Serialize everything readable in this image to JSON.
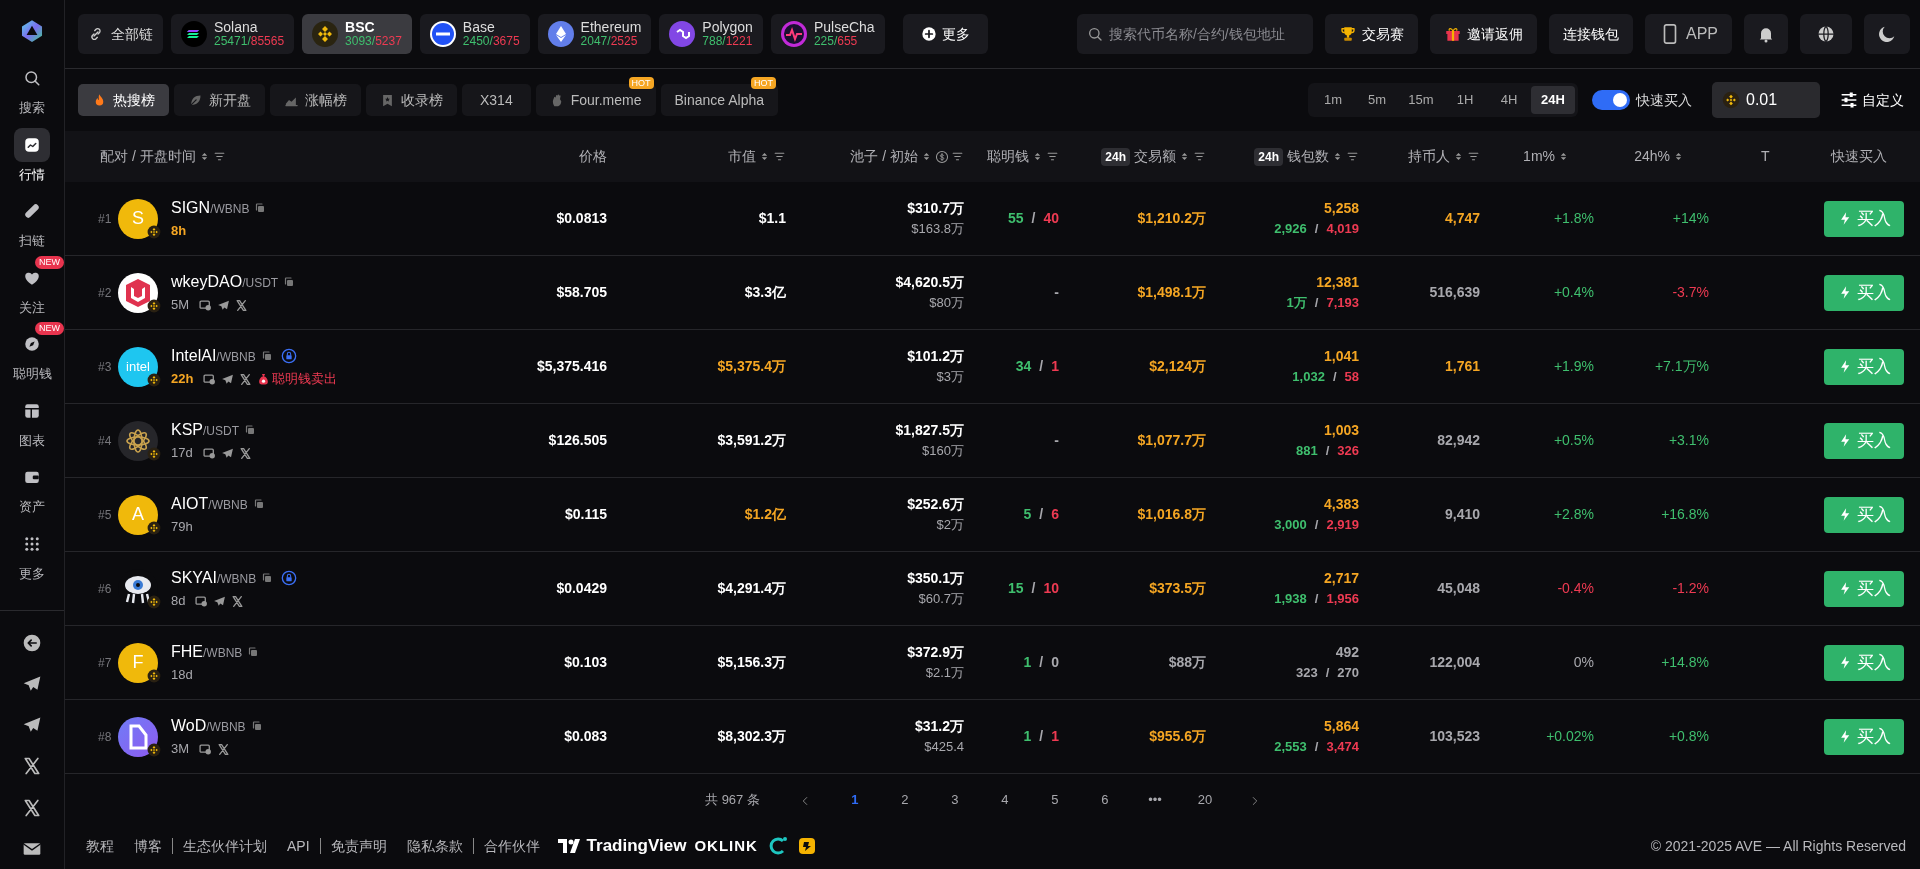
{
  "sidebar": {
    "items": [
      {
        "label": "搜索",
        "selected": false
      },
      {
        "label": "行情",
        "selected": true
      },
      {
        "label": "扫链",
        "selected": false
      },
      {
        "label": "关注",
        "selected": false,
        "badge": "NEW"
      },
      {
        "label": "聪明钱",
        "selected": false,
        "badge": "NEW"
      },
      {
        "label": "图表",
        "selected": false
      },
      {
        "label": "资产",
        "selected": false
      },
      {
        "label": "更多",
        "selected": false
      }
    ]
  },
  "chains": [
    {
      "label": "全部链",
      "selected": false
    },
    {
      "label": "Solana",
      "counts": [
        "25471",
        "/",
        "85565"
      ],
      "selected": false
    },
    {
      "label": "BSC",
      "counts": [
        "3093",
        "/",
        "5237"
      ],
      "selected": true
    },
    {
      "label": "Base",
      "counts": [
        "2450",
        "/",
        "3675"
      ],
      "selected": false
    },
    {
      "label": "Ethereum",
      "counts": [
        "2047",
        "/",
        "2525"
      ],
      "selected": false
    },
    {
      "label": "Polygon",
      "counts": [
        "788",
        "/",
        "1221"
      ],
      "selected": false
    },
    {
      "label": "PulseCha",
      "counts": [
        "225",
        "/",
        "655"
      ],
      "selected": false
    }
  ],
  "more_button": "更多",
  "search": {
    "placeholder": "搜索代币名称/合约/钱包地址"
  },
  "top_buttons": [
    "交易赛",
    "邀请返佣",
    "连接钱包",
    "APP"
  ],
  "filters": [
    {
      "label": "热搜榜",
      "selected": true
    },
    {
      "label": "新开盘",
      "selected": false
    },
    {
      "label": "涨幅榜",
      "selected": false
    },
    {
      "label": "收录榜",
      "selected": false
    },
    {
      "label": "X314",
      "selected": false
    },
    {
      "label": "Four.meme",
      "selected": false,
      "badge": "HOT"
    },
    {
      "label": "Binance Alpha",
      "selected": false,
      "badge": "HOT"
    }
  ],
  "intervals": [
    {
      "label": "1m",
      "selected": false
    },
    {
      "label": "5m",
      "selected": false
    },
    {
      "label": "15m",
      "selected": false
    },
    {
      "label": "1H",
      "selected": false
    },
    {
      "label": "4H",
      "selected": false
    },
    {
      "label": "24H",
      "selected": true
    }
  ],
  "quick_buy": {
    "label": "快速买入",
    "on": true,
    "amount": "0.01"
  },
  "customize": "自定义",
  "columns": [
    {
      "label": "配对 / 开盘时间",
      "sort": true,
      "filter": true
    },
    {
      "label": "价格"
    },
    {
      "label": "市值",
      "sort": true,
      "filter": true
    },
    {
      "label": "池子 / 初始",
      "sort": true,
      "currency": true,
      "filter": true
    },
    {
      "label": "聪明钱",
      "sort": true,
      "filter": true
    },
    {
      "badge": "24h",
      "label": "交易额",
      "sort": true,
      "filter": true
    },
    {
      "badge": "24h",
      "label": "钱包数",
      "sort": true,
      "filter": true
    },
    {
      "label": "持币人",
      "sort": true,
      "filter": true
    },
    {
      "label": "1m%",
      "sort": true
    },
    {
      "label": "24h%",
      "sort": true
    },
    {
      "label": "T"
    },
    {
      "label": "快速买入"
    }
  ],
  "rows": [
    {
      "rank": "#1",
      "avatar": {
        "kind": "letter",
        "text": "S"
      },
      "symbol": "SIGN",
      "quote": "/WBNB",
      "age": "8h",
      "age_hot": true,
      "links": [],
      "lock": false,
      "price": "$0.0813",
      "mcap": {
        "text": "$1.1",
        "color": "#ffffff"
      },
      "pool": "$310.7万",
      "initial": "$163.8万",
      "smart": [
        {
          "text": "55",
          "color": "#3fbf6e"
        },
        {
          "text": "/",
          "color": "#a8a8ad"
        },
        {
          "text": "40",
          "color": "#ee3a52"
        }
      ],
      "volume": {
        "text": "$1,210.2万",
        "color": "#f5a623"
      },
      "wallets": {
        "text": "5,258",
        "color": "#f5a623"
      },
      "traders": [
        {
          "text": "2,926",
          "color": "#3fbf6e"
        },
        {
          "text": "/",
          "color": "#a8a8ad"
        },
        {
          "text": "4,019",
          "color": "#ee3a52"
        }
      ],
      "holders": {
        "text": "4,747",
        "color": "#f5a623"
      },
      "change_1m": {
        "text": "+1.8%",
        "color": "#3fbf6e"
      },
      "change_24h": {
        "text": "+14%",
        "color": "#3fbf6e"
      },
      "buy": "买入"
    },
    {
      "rank": "#2",
      "avatar": {
        "kind": "shield"
      },
      "symbol": "wkeyDAO",
      "quote": "/USDT",
      "age": "5M",
      "age_hot": false,
      "links": [
        {
          "kind": "web"
        },
        {
          "kind": "telegram"
        },
        {
          "kind": "x"
        }
      ],
      "lock": false,
      "price": "$58.705",
      "mcap": {
        "text": "$3.3亿",
        "color": "#ffffff"
      },
      "pool": "$4,620.5万",
      "initial": "$80万",
      "smart": [
        {
          "text": "-",
          "color": "#a8a8ad"
        }
      ],
      "volume": {
        "text": "$1,498.1万",
        "color": "#f5a623"
      },
      "wallets": {
        "text": "12,381",
        "color": "#f5a623"
      },
      "traders": [
        {
          "text": "1万",
          "color": "#3fbf6e"
        },
        {
          "text": "/",
          "color": "#a8a8ad"
        },
        {
          "text": "7,193",
          "color": "#ee3a52"
        }
      ],
      "holders": {
        "text": "516,639",
        "color": "#a8a8ad"
      },
      "change_1m": {
        "text": "+0.4%",
        "color": "#3fbf6e"
      },
      "change_24h": {
        "text": "-3.7%",
        "color": "#ee3a52"
      },
      "buy": "买入"
    },
    {
      "rank": "#3",
      "avatar": {
        "kind": "text",
        "text": "intel"
      },
      "symbol": "IntelAI",
      "quote": "/WBNB",
      "age": "22h",
      "age_hot": true,
      "links": [
        {
          "kind": "web"
        },
        {
          "kind": "telegram"
        },
        {
          "kind": "x"
        }
      ],
      "lock": true,
      "alert": "聪明钱卖出",
      "price": "$5,375.416",
      "mcap": {
        "text": "$5,375.4万",
        "color": "#f5a623"
      },
      "pool": "$101.2万",
      "initial": "$3万",
      "smart": [
        {
          "text": "34",
          "color": "#3fbf6e"
        },
        {
          "text": "/",
          "color": "#a8a8ad"
        },
        {
          "text": "1",
          "color": "#ee3a52"
        }
      ],
      "volume": {
        "text": "$2,124万",
        "color": "#f5a623"
      },
      "wallets": {
        "text": "1,041",
        "color": "#f5a623"
      },
      "traders": [
        {
          "text": "1,032",
          "color": "#3fbf6e"
        },
        {
          "text": "/",
          "color": "#a8a8ad"
        },
        {
          "text": "58",
          "color": "#ee3a52"
        }
      ],
      "holders": {
        "text": "1,761",
        "color": "#f5a623"
      },
      "change_1m": {
        "text": "+1.9%",
        "color": "#3fbf6e"
      },
      "change_24h": {
        "text": "+7.1万%",
        "color": "#3fbf6e"
      },
      "buy": "买入"
    },
    {
      "rank": "#4",
      "avatar": {
        "kind": "flower"
      },
      "symbol": "KSP",
      "quote": "/USDT",
      "age": "17d",
      "age_hot": false,
      "links": [
        {
          "kind": "web"
        },
        {
          "kind": "telegram"
        },
        {
          "kind": "x"
        }
      ],
      "lock": false,
      "price": "$126.505",
      "mcap": {
        "text": "$3,591.2万",
        "color": "#ffffff"
      },
      "pool": "$1,827.5万",
      "initial": "$160万",
      "smart": [
        {
          "text": "-",
          "color": "#a8a8ad"
        }
      ],
      "volume": {
        "text": "$1,077.7万",
        "color": "#f5a623"
      },
      "wallets": {
        "text": "1,003",
        "color": "#f5a623"
      },
      "traders": [
        {
          "text": "881",
          "color": "#3fbf6e"
        },
        {
          "text": "/",
          "color": "#a8a8ad"
        },
        {
          "text": "326",
          "color": "#ee3a52"
        }
      ],
      "holders": {
        "text": "82,942",
        "color": "#a8a8ad"
      },
      "change_1m": {
        "text": "+0.5%",
        "color": "#3fbf6e"
      },
      "change_24h": {
        "text": "+3.1%",
        "color": "#3fbf6e"
      },
      "buy": "买入"
    },
    {
      "rank": "#5",
      "avatar": {
        "kind": "letter",
        "text": "A"
      },
      "symbol": "AIOT",
      "quote": "/WBNB",
      "age": "79h",
      "age_hot": false,
      "links": [],
      "lock": false,
      "price": "$0.115",
      "mcap": {
        "text": "$1.2亿",
        "color": "#f5a623"
      },
      "pool": "$252.6万",
      "initial": "$2万",
      "smart": [
        {
          "text": "5",
          "color": "#3fbf6e"
        },
        {
          "text": "/",
          "color": "#a8a8ad"
        },
        {
          "text": "6",
          "color": "#ee3a52"
        }
      ],
      "volume": {
        "text": "$1,016.8万",
        "color": "#f5a623"
      },
      "wallets": {
        "text": "4,383",
        "color": "#f5a623"
      },
      "traders": [
        {
          "text": "3,000",
          "color": "#3fbf6e"
        },
        {
          "text": "/",
          "color": "#a8a8ad"
        },
        {
          "text": "2,919",
          "color": "#ee3a52"
        }
      ],
      "holders": {
        "text": "9,410",
        "color": "#a8a8ad"
      },
      "change_1m": {
        "text": "+2.8%",
        "color": "#3fbf6e"
      },
      "change_24h": {
        "text": "+16.8%",
        "color": "#3fbf6e"
      },
      "buy": "买入"
    },
    {
      "rank": "#6",
      "avatar": {
        "kind": "robot"
      },
      "symbol": "SKYAI",
      "quote": "/WBNB",
      "age": "8d",
      "age_hot": false,
      "links": [
        {
          "kind": "web"
        },
        {
          "kind": "telegram"
        },
        {
          "kind": "x"
        }
      ],
      "lock": true,
      "price": "$0.0429",
      "mcap": {
        "text": "$4,291.4万",
        "color": "#ffffff"
      },
      "pool": "$350.1万",
      "initial": "$60.7万",
      "smart": [
        {
          "text": "15",
          "color": "#3fbf6e"
        },
        {
          "text": "/",
          "color": "#a8a8ad"
        },
        {
          "text": "10",
          "color": "#ee3a52"
        }
      ],
      "volume": {
        "text": "$373.5万",
        "color": "#f5a623"
      },
      "wallets": {
        "text": "2,717",
        "color": "#f5a623"
      },
      "traders": [
        {
          "text": "1,938",
          "color": "#3fbf6e"
        },
        {
          "text": "/",
          "color": "#a8a8ad"
        },
        {
          "text": "1,956",
          "color": "#ee3a52"
        }
      ],
      "holders": {
        "text": "45,048",
        "color": "#a8a8ad"
      },
      "change_1m": {
        "text": "-0.4%",
        "color": "#ee3a52"
      },
      "change_24h": {
        "text": "-1.2%",
        "color": "#ee3a52"
      },
      "buy": "买入"
    },
    {
      "rank": "#7",
      "avatar": {
        "kind": "letter",
        "text": "F"
      },
      "symbol": "FHE",
      "quote": "/WBNB",
      "age": "18d",
      "age_hot": false,
      "links": [],
      "lock": false,
      "price": "$0.103",
      "mcap": {
        "text": "$5,156.3万",
        "color": "#ffffff"
      },
      "pool": "$372.9万",
      "initial": "$2.1万",
      "smart": [
        {
          "text": "1",
          "color": "#3fbf6e"
        },
        {
          "text": "/",
          "color": "#a8a8ad"
        },
        {
          "text": "0",
          "color": "#a8a8ad"
        }
      ],
      "volume": {
        "text": "$88万",
        "color": "#a8a8ad"
      },
      "wallets": {
        "text": "492",
        "color": "#a8a8ad"
      },
      "traders": [
        {
          "text": "323",
          "color": "#a8a8ad"
        },
        {
          "text": "/",
          "color": "#a8a8ad"
        },
        {
          "text": "270",
          "color": "#a8a8ad"
        }
      ],
      "holders": {
        "text": "122,004",
        "color": "#a8a8ad"
      },
      "change_1m": {
        "text": "0%",
        "color": "#a8a8ad"
      },
      "change_24h": {
        "text": "+14.8%",
        "color": "#3fbf6e"
      },
      "buy": "买入"
    },
    {
      "rank": "#8",
      "avatar": {
        "kind": "doc"
      },
      "symbol": "WoD",
      "quote": "/WBNB",
      "age": "3M",
      "age_hot": false,
      "links": [
        {
          "kind": "web"
        },
        {
          "kind": "x"
        }
      ],
      "lock": false,
      "price": "$0.083",
      "mcap": {
        "text": "$8,302.3万",
        "color": "#ffffff"
      },
      "pool": "$31.2万",
      "initial": "$425.4",
      "smart": [
        {
          "text": "1",
          "color": "#3fbf6e"
        },
        {
          "text": "/",
          "color": "#a8a8ad"
        },
        {
          "text": "1",
          "color": "#ee3a52"
        }
      ],
      "volume": {
        "text": "$955.6万",
        "color": "#f5a623"
      },
      "wallets": {
        "text": "5,864",
        "color": "#f5a623"
      },
      "traders": [
        {
          "text": "2,553",
          "color": "#3fbf6e"
        },
        {
          "text": "/",
          "color": "#a8a8ad"
        },
        {
          "text": "3,474",
          "color": "#ee3a52"
        }
      ],
      "holders": {
        "text": "103,523",
        "color": "#a8a8ad"
      },
      "change_1m": {
        "text": "+0.02%",
        "color": "#3fbf6e"
      },
      "change_24h": {
        "text": "+0.8%",
        "color": "#3fbf6e"
      },
      "buy": "买入"
    }
  ],
  "pagination": {
    "total": "共 967 条",
    "pages": [
      {
        "label": "1",
        "selected": true
      },
      {
        "label": "2",
        "selected": false
      },
      {
        "label": "3",
        "selected": false
      },
      {
        "label": "4",
        "selected": false
      },
      {
        "label": "5",
        "selected": false
      },
      {
        "label": "6",
        "selected": false
      },
      {
        "label": "•••",
        "selected": false
      },
      {
        "label": "20",
        "selected": false
      }
    ]
  },
  "footer": {
    "links": [
      {
        "label": "教程",
        "divider_after": false
      },
      {
        "label": "博客",
        "divider_after": true
      },
      {
        "label": "生态伙伴计划",
        "divider_after": false
      },
      {
        "label": "API",
        "divider_after": true
      },
      {
        "label": "免责声明",
        "divider_after": false
      },
      {
        "label": "隐私条款",
        "divider_after": true
      },
      {
        "label": "合作伙伴",
        "divider_after": false
      }
    ],
    "partners": [
      "TradingView",
      "OKLINK"
    ],
    "copyright": "© 2021-2025 AVE — All Rights Reserved"
  }
}
